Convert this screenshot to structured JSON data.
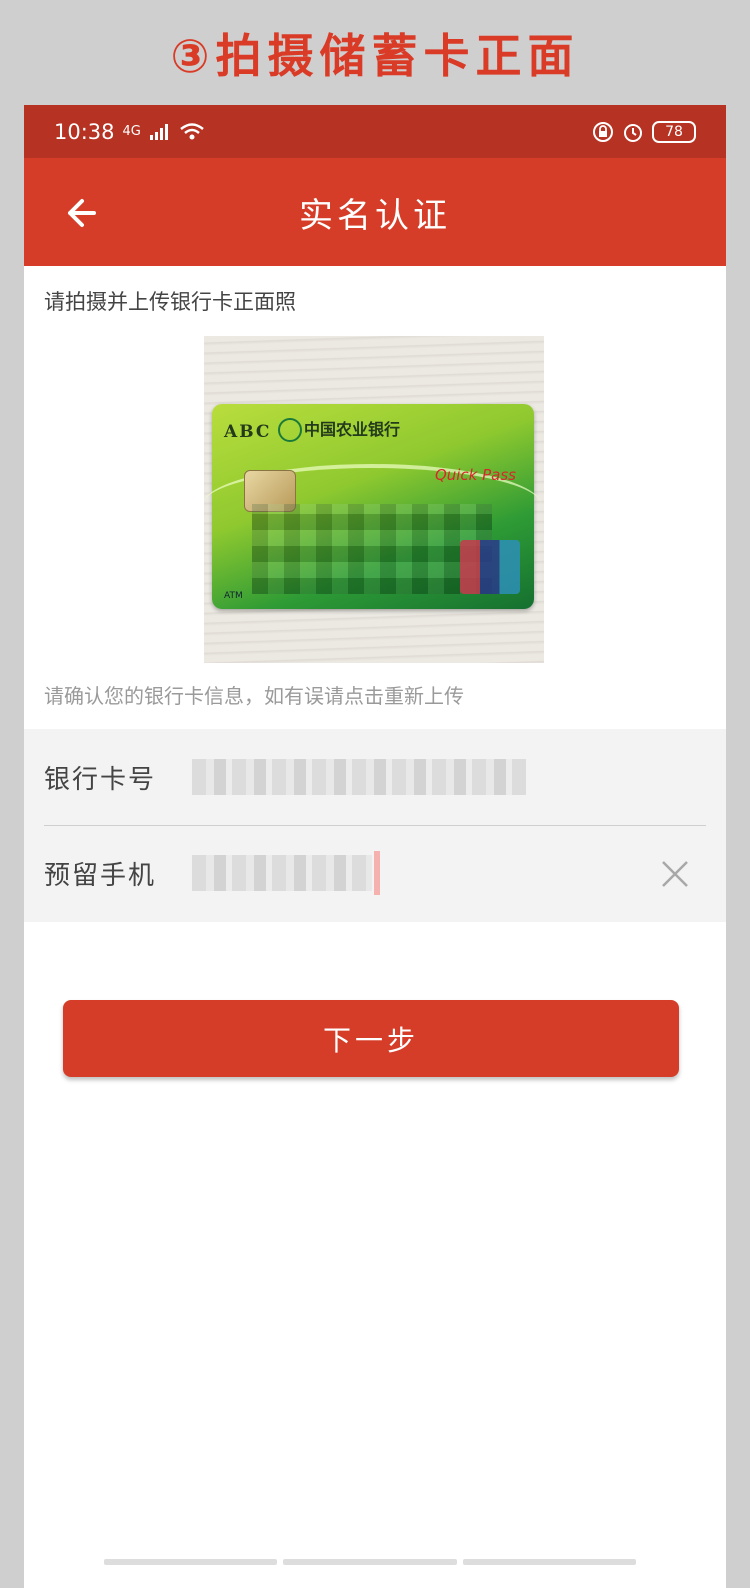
{
  "banner": {
    "text": "③拍摄储蓄卡正面"
  },
  "status_bar": {
    "time": "10:38",
    "network": "4G",
    "battery": "78"
  },
  "app_bar": {
    "title": "实名认证"
  },
  "upload": {
    "instruction": "请拍摄并上传银行卡正面照",
    "card": {
      "brand_short": "ABC",
      "bank_name": "中国农业银行",
      "quickpass": "Quick Pass",
      "atm": "ATM"
    },
    "confirm_hint": "请确认您的银行卡信息，如有误请点击重新上传"
  },
  "form": {
    "card_number_label": "银行卡号",
    "phone_label": "预留手机"
  },
  "actions": {
    "next_label": "下一步"
  },
  "colors": {
    "accent": "#d63d28",
    "status_bar": "#b63222",
    "banner_text": "#d93b27"
  }
}
